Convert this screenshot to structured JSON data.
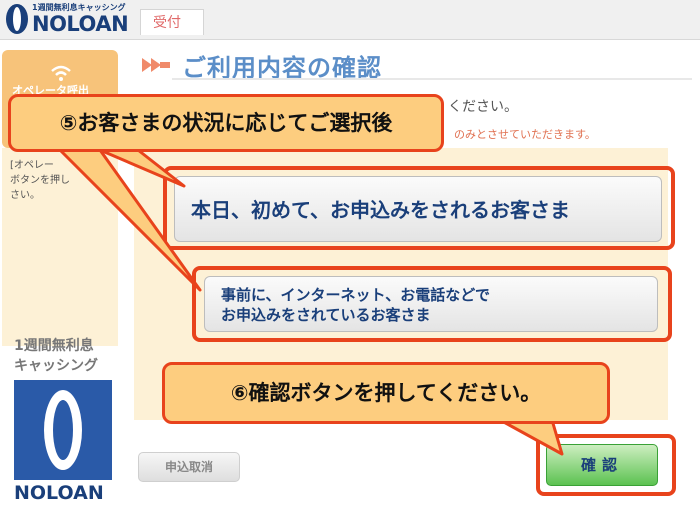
{
  "header": {
    "logo_subtitle": "1週間無利息キャッシング",
    "logo_text": "NOLOAN",
    "tab_label": "受付"
  },
  "sidebar": {
    "operator_button_label": "オペレータ呼出",
    "note_lines": [
      "[オペレー",
      "ボタンを押し",
      "さい。"
    ],
    "brand_line1": "1週間無利息",
    "brand_line2": "キャッシング",
    "brand_logo": "NOLOAN"
  },
  "main": {
    "title": "ご利用内容の確認",
    "instruction_tail": "ください。",
    "note_tail": "のみとさせていただきます。",
    "choice1_label": "本日、初めて、お申込みをされるお客さま",
    "choice2_line1": "事前に、インターネット、お電話などで",
    "choice2_line2": "お申込みをされているお客さま",
    "cancel_label": "申込取消",
    "confirm_label": "確認"
  },
  "annotations": {
    "step5": "⑤お客さまの状況に応じてご選択後",
    "step6": "⑥確認ボタンを押してください。"
  },
  "colors": {
    "brand_blue": "#1a3f7a",
    "title_blue": "#5b8ec8",
    "callout_fill": "#fdcd7f",
    "callout_border": "#e8431c",
    "confirm_green": "#5cc251",
    "panel_cream": "#fdf1d6"
  }
}
